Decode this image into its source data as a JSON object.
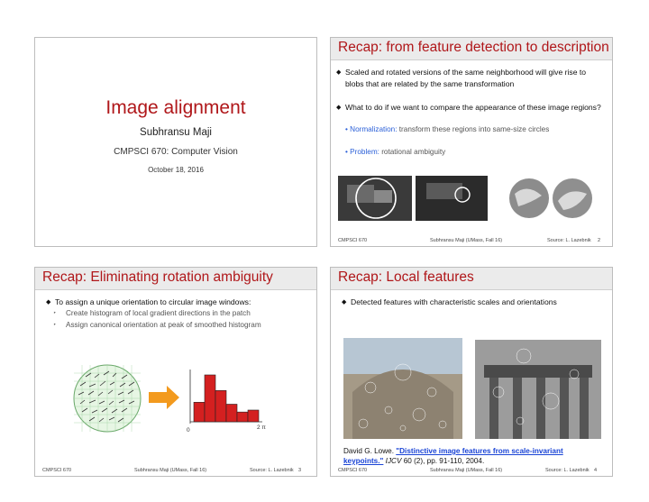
{
  "slide1": {
    "title": "Image alignment",
    "author": "Subhransu Maji",
    "course": "CMPSCI 670: Computer Vision",
    "date": "October 18, 2016"
  },
  "slide2": {
    "title": "Recap: from feature detection to description",
    "bullet1": "Scaled and rotated versions of the same neighborhood will give rise to blobs that are related by the same transformation",
    "bullet2": "What to do if we want to compare the appearance of these image regions?",
    "sub1_label": "Normalization:",
    "sub1_text": " transform these regions into same-size circles",
    "sub2_label": "Problem:",
    "sub2_text": " rotational ambiguity",
    "footer_left": "CMPSCI 670",
    "footer_center": "Subhransu Maji (UMass, Fall 16)",
    "footer_source": "Source: L. Lazebnik",
    "page": "2"
  },
  "slide3": {
    "title": "Recap: Eliminating rotation ambiguity",
    "bullet1": "To assign a unique orientation to circular image windows:",
    "sub1": "Create histogram of local gradient directions in the patch",
    "sub2": "Assign canonical orientation at peak of smoothed histogram",
    "axis_start": "0",
    "axis_end": "2 π",
    "footer_left": "CMPSCI 670",
    "footer_center": "Subhransu Maji (UMass, Fall 16)",
    "footer_source": "Source: L. Lazebnik",
    "page": "3"
  },
  "slide4": {
    "title": "Recap: Local features",
    "bullet1": "Detected features with characteristic scales and orientations",
    "citation_author": "David G. Lowe. ",
    "citation_link": "\"Distinctive image features from scale-invariant keypoints.\"",
    "citation_journal": " IJCV",
    "citation_rest": " 60 (2), pp. 91-110, 2004.",
    "footer_left": "CMPSCI 670",
    "footer_center": "Subhransu Maji (UMass, Fall 16)",
    "footer_source": "Source: L. Lazebnik",
    "page": "4"
  },
  "colors": {
    "title_red": "#b0171a",
    "blue": "#2a5fd8",
    "hist_red": "#d42020",
    "arrow_orange": "#f39a1e"
  }
}
